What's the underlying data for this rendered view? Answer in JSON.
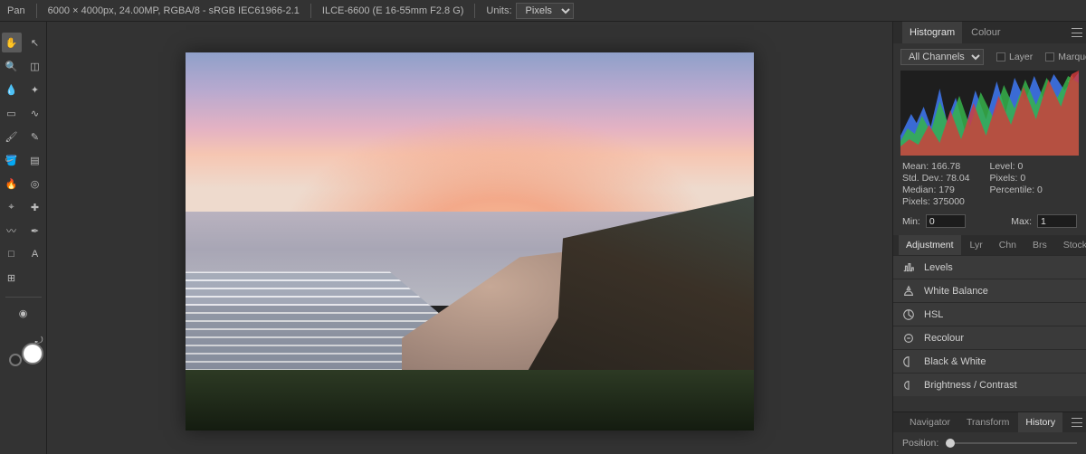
{
  "context_bar": {
    "tool_name": "Pan",
    "image_info": "6000 × 4000px, 24.00MP, RGBA/8 - sRGB IEC61966-2.1",
    "camera_info": "ILCE-6600 (E 16-55mm F2.8 G)",
    "units_label": "Units:",
    "units_value": "Pixels"
  },
  "toolbox": {
    "tools": [
      {
        "name": "hand-tool",
        "glyph": "✋"
      },
      {
        "name": "move-tool",
        "glyph": "↖"
      },
      {
        "name": "zoom-tool",
        "glyph": "🔍"
      },
      {
        "name": "crop-tool",
        "glyph": "◫"
      },
      {
        "name": "eyedropper-tool",
        "glyph": "💧"
      },
      {
        "name": "auto-tool",
        "glyph": "✦"
      },
      {
        "name": "marquee-tool",
        "glyph": "▭"
      },
      {
        "name": "freehand-tool",
        "glyph": "∿"
      },
      {
        "name": "brush-tool",
        "glyph": "🖌"
      },
      {
        "name": "pencil-tool",
        "glyph": "✎"
      },
      {
        "name": "fill-tool",
        "glyph": "🪣"
      },
      {
        "name": "gradient-tool",
        "glyph": "▤"
      },
      {
        "name": "burn-tool",
        "glyph": "🔥"
      },
      {
        "name": "sponge-tool",
        "glyph": "◎"
      },
      {
        "name": "clone-tool",
        "glyph": "⌖"
      },
      {
        "name": "heal-tool",
        "glyph": "✚"
      },
      {
        "name": "smudge-tool",
        "glyph": "〰"
      },
      {
        "name": "pen-tool",
        "glyph": "✒"
      },
      {
        "name": "shape-tool",
        "glyph": "□"
      },
      {
        "name": "text-tool",
        "glyph": "A"
      },
      {
        "name": "mesh-tool",
        "glyph": "⊞"
      },
      {
        "name": "blank-tool",
        "glyph": ""
      }
    ],
    "extra_tool": {
      "name": "quick-mask",
      "glyph": "◉"
    },
    "fore_color": "#ffffff",
    "back_color": "#2b2b2b"
  },
  "right_panel": {
    "top_tabs": {
      "histogram": "Histogram",
      "colour": "Colour"
    },
    "hist_opts": {
      "channel": "All Channels",
      "layer_label": "Layer",
      "marquee_label": "Marquee"
    },
    "stats": {
      "mean_label": "Mean:",
      "mean_val": "166.78",
      "level_label": "Level:",
      "level_val": "0",
      "std_label": "Std. Dev.:",
      "std_val": "78.04",
      "pixels2_label": "Pixels:",
      "pixels2_val": "0",
      "median_label": "Median:",
      "median_val": "179",
      "perc_label": "Percentile:",
      "perc_val": "0",
      "pixels_label": "Pixels:",
      "pixels_val": "375000",
      "min_label": "Min:",
      "min_val": "0",
      "max_label": "Max:",
      "max_val": "1"
    },
    "mid_tabs": {
      "adjustment": "Adjustment",
      "lyr": "Lyr",
      "chn": "Chn",
      "brs": "Brs",
      "stock": "Stock"
    },
    "adjustments": [
      {
        "name": "levels",
        "label": "Levels"
      },
      {
        "name": "white-balance",
        "label": "White Balance"
      },
      {
        "name": "hsl",
        "label": "HSL"
      },
      {
        "name": "recolour",
        "label": "Recolour"
      },
      {
        "name": "black-white",
        "label": "Black & White"
      },
      {
        "name": "brightness-contrast",
        "label": "Brightness / Contrast"
      }
    ],
    "bottom_tabs": {
      "navigator": "Navigator",
      "transform": "Transform",
      "history": "History"
    },
    "position_label": "Position:"
  }
}
